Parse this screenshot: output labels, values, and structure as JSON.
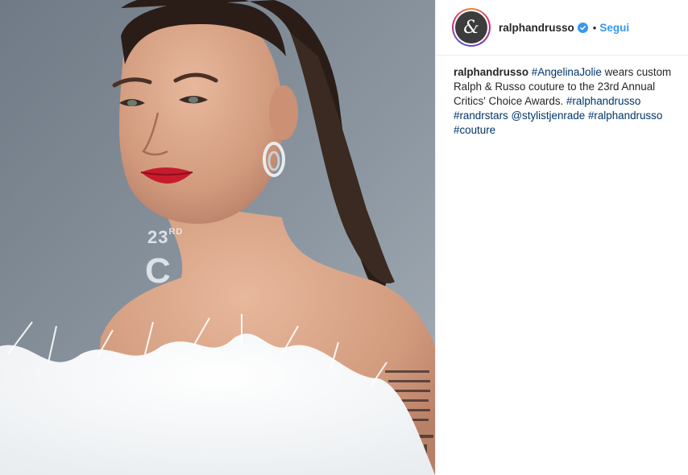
{
  "photo": {
    "alt": "",
    "backdrop_number": "23",
    "backdrop_superscript": "RD",
    "backdrop_letter": "C"
  },
  "header": {
    "avatar_glyph": "&",
    "username": "ralphandrusso",
    "verified": true,
    "separator": "•",
    "follow_label": "Segui"
  },
  "caption": {
    "author": "ralphandrusso",
    "hashtag_angelina": "#AngelinaJolie",
    "text_1": " wears custom Ralph & Russo couture to the 23rd Annual Critics' Choice Awards. ",
    "hashtag_ralphandrusso_1": "#ralphandrusso",
    "hashtag_randrstars": "#randrstars",
    "mention_stylist": "@stylistjenrade",
    "hashtag_ralphandrusso_2": "#ralphandrusso",
    "hashtag_couture": "#couture"
  },
  "colors": {
    "link_blue": "#3897f0",
    "hashtag_navy": "#003569",
    "text": "#262626",
    "border": "#efefef"
  }
}
